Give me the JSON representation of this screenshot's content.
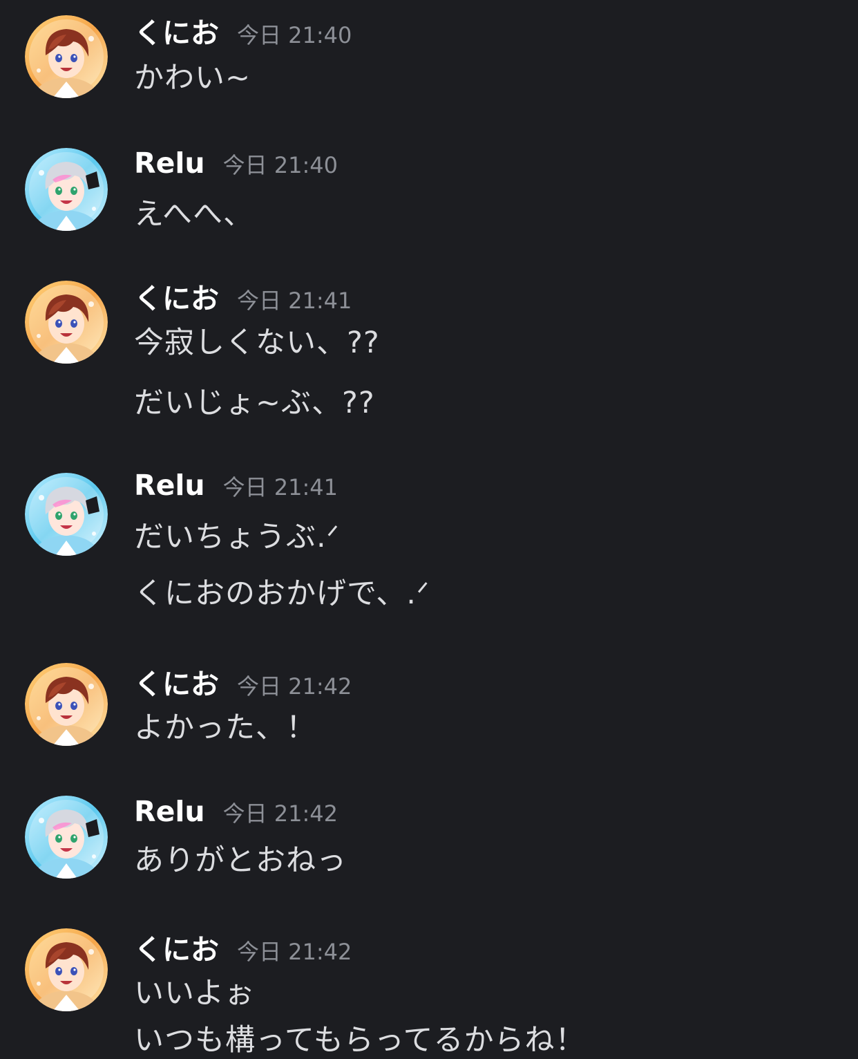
{
  "users": {
    "kunio": {
      "name": "くにお",
      "avatar_icon": "kunio-avatar",
      "accent": "#f3a34a"
    },
    "relu": {
      "name": "Relu",
      "avatar_icon": "relu-avatar",
      "accent": "#6fd2ef"
    }
  },
  "messages": [
    {
      "author": "くにお",
      "time": "今日 21:40",
      "lines": [
        "かわい~"
      ]
    },
    {
      "author": "Relu",
      "time": "今日 21:40",
      "lines": [
        "えへへ、"
      ]
    },
    {
      "author": "くにお",
      "time": "今日 21:41",
      "lines": [
        "今寂しくない、??",
        "だいじょ~ぶ、??"
      ]
    },
    {
      "author": "Relu",
      "time": "今日 21:41",
      "lines": [
        "だいちょうぶ.ᐟ",
        "くにおのおかげで、.ᐟ"
      ]
    },
    {
      "author": "くにお",
      "time": "今日 21:42",
      "lines": [
        "よかった、！"
      ]
    },
    {
      "author": "Relu",
      "time": "今日 21:42",
      "lines": [
        "ありがとおねっ"
      ]
    },
    {
      "author": "くにお",
      "time": "今日 21:42",
      "lines": [
        "いいよぉ",
        "いつも構ってもらってるからね！"
      ]
    }
  ]
}
